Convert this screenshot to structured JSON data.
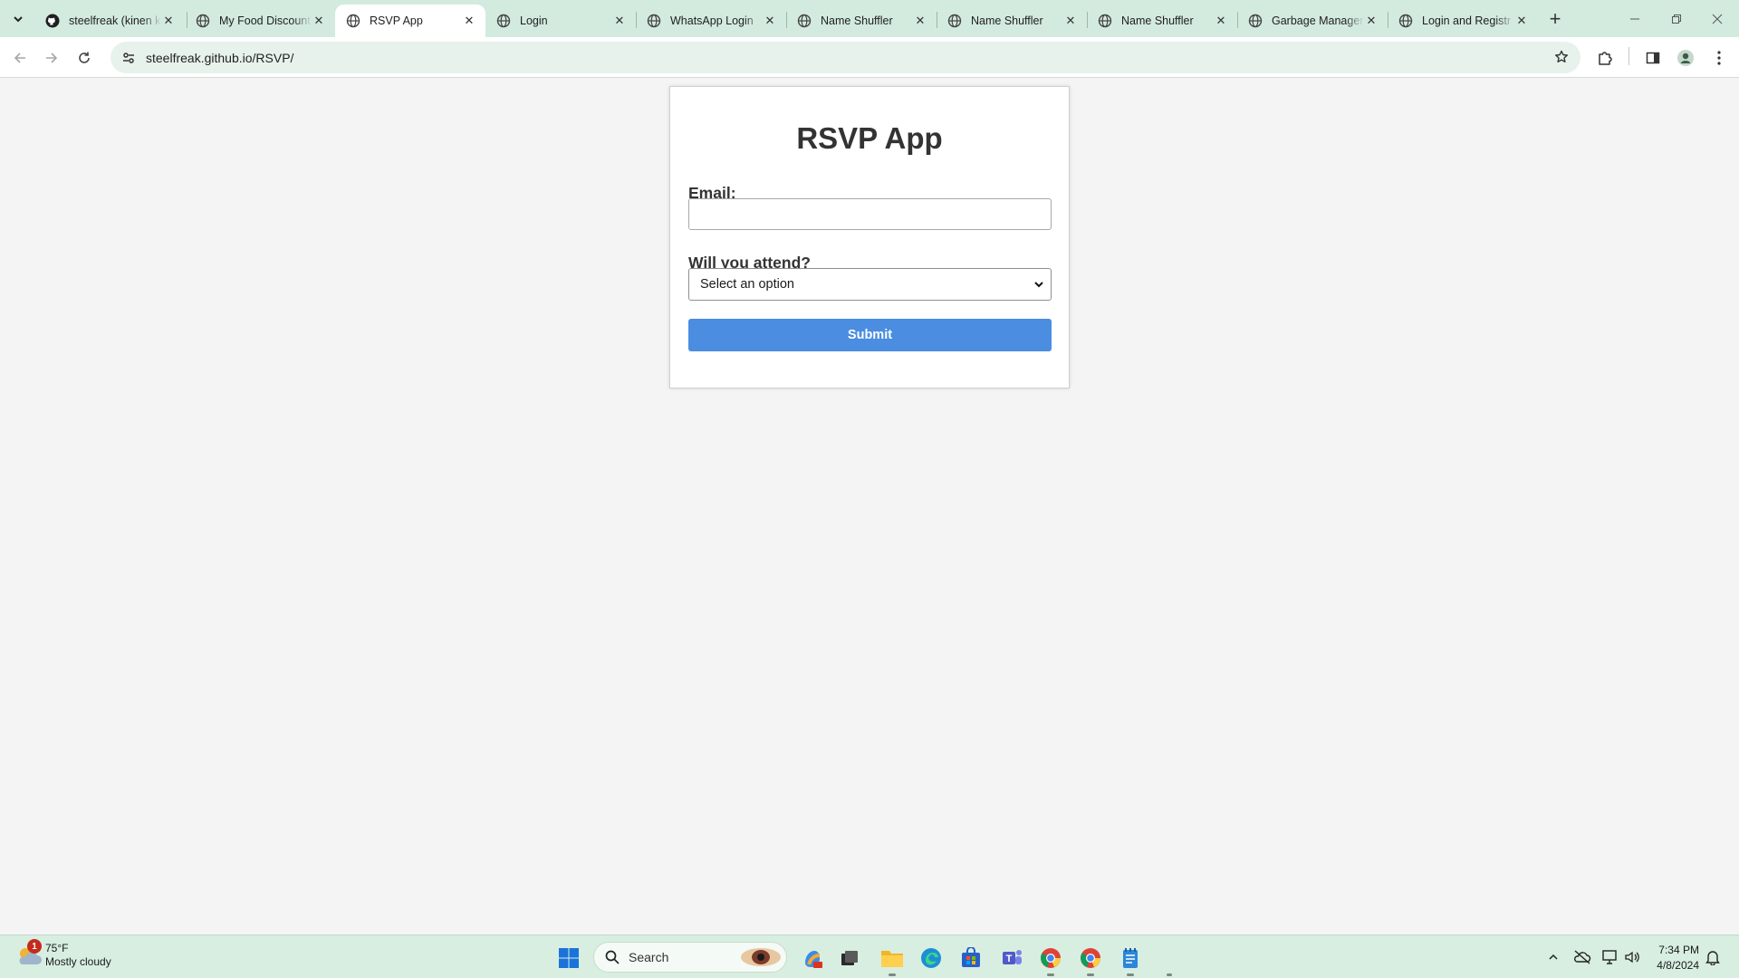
{
  "browser": {
    "tabs": [
      {
        "title": "steelfreak (kinen k",
        "favicon": "github-icon"
      },
      {
        "title": "My Food Discount",
        "favicon": "globe-icon"
      },
      {
        "title": "RSVP App",
        "favicon": "globe-icon",
        "active": true
      },
      {
        "title": "Login",
        "favicon": "globe-icon"
      },
      {
        "title": "WhatsApp Login",
        "favicon": "globe-icon"
      },
      {
        "title": "Name Shuffler",
        "favicon": "globe-icon"
      },
      {
        "title": "Name Shuffler",
        "favicon": "globe-icon"
      },
      {
        "title": "Name Shuffler",
        "favicon": "globe-icon"
      },
      {
        "title": "Garbage Manager",
        "favicon": "globe-icon"
      },
      {
        "title": "Login and Registr",
        "favicon": "globe-icon"
      }
    ],
    "url": "steelfreak.github.io/RSVP/"
  },
  "page": {
    "title": "RSVP App",
    "email_label": "Email:",
    "email_value": "",
    "attend_label": "Will you attend?",
    "attend_selected": "Select an option",
    "submit_label": "Submit",
    "accent_color": "#4a8de1"
  },
  "taskbar": {
    "weather_temp": "75°F",
    "weather_desc": "Mostly cloudy",
    "weather_badge": "1",
    "search_placeholder": "Search",
    "time": "7:34 PM",
    "date": "4/8/2024"
  }
}
